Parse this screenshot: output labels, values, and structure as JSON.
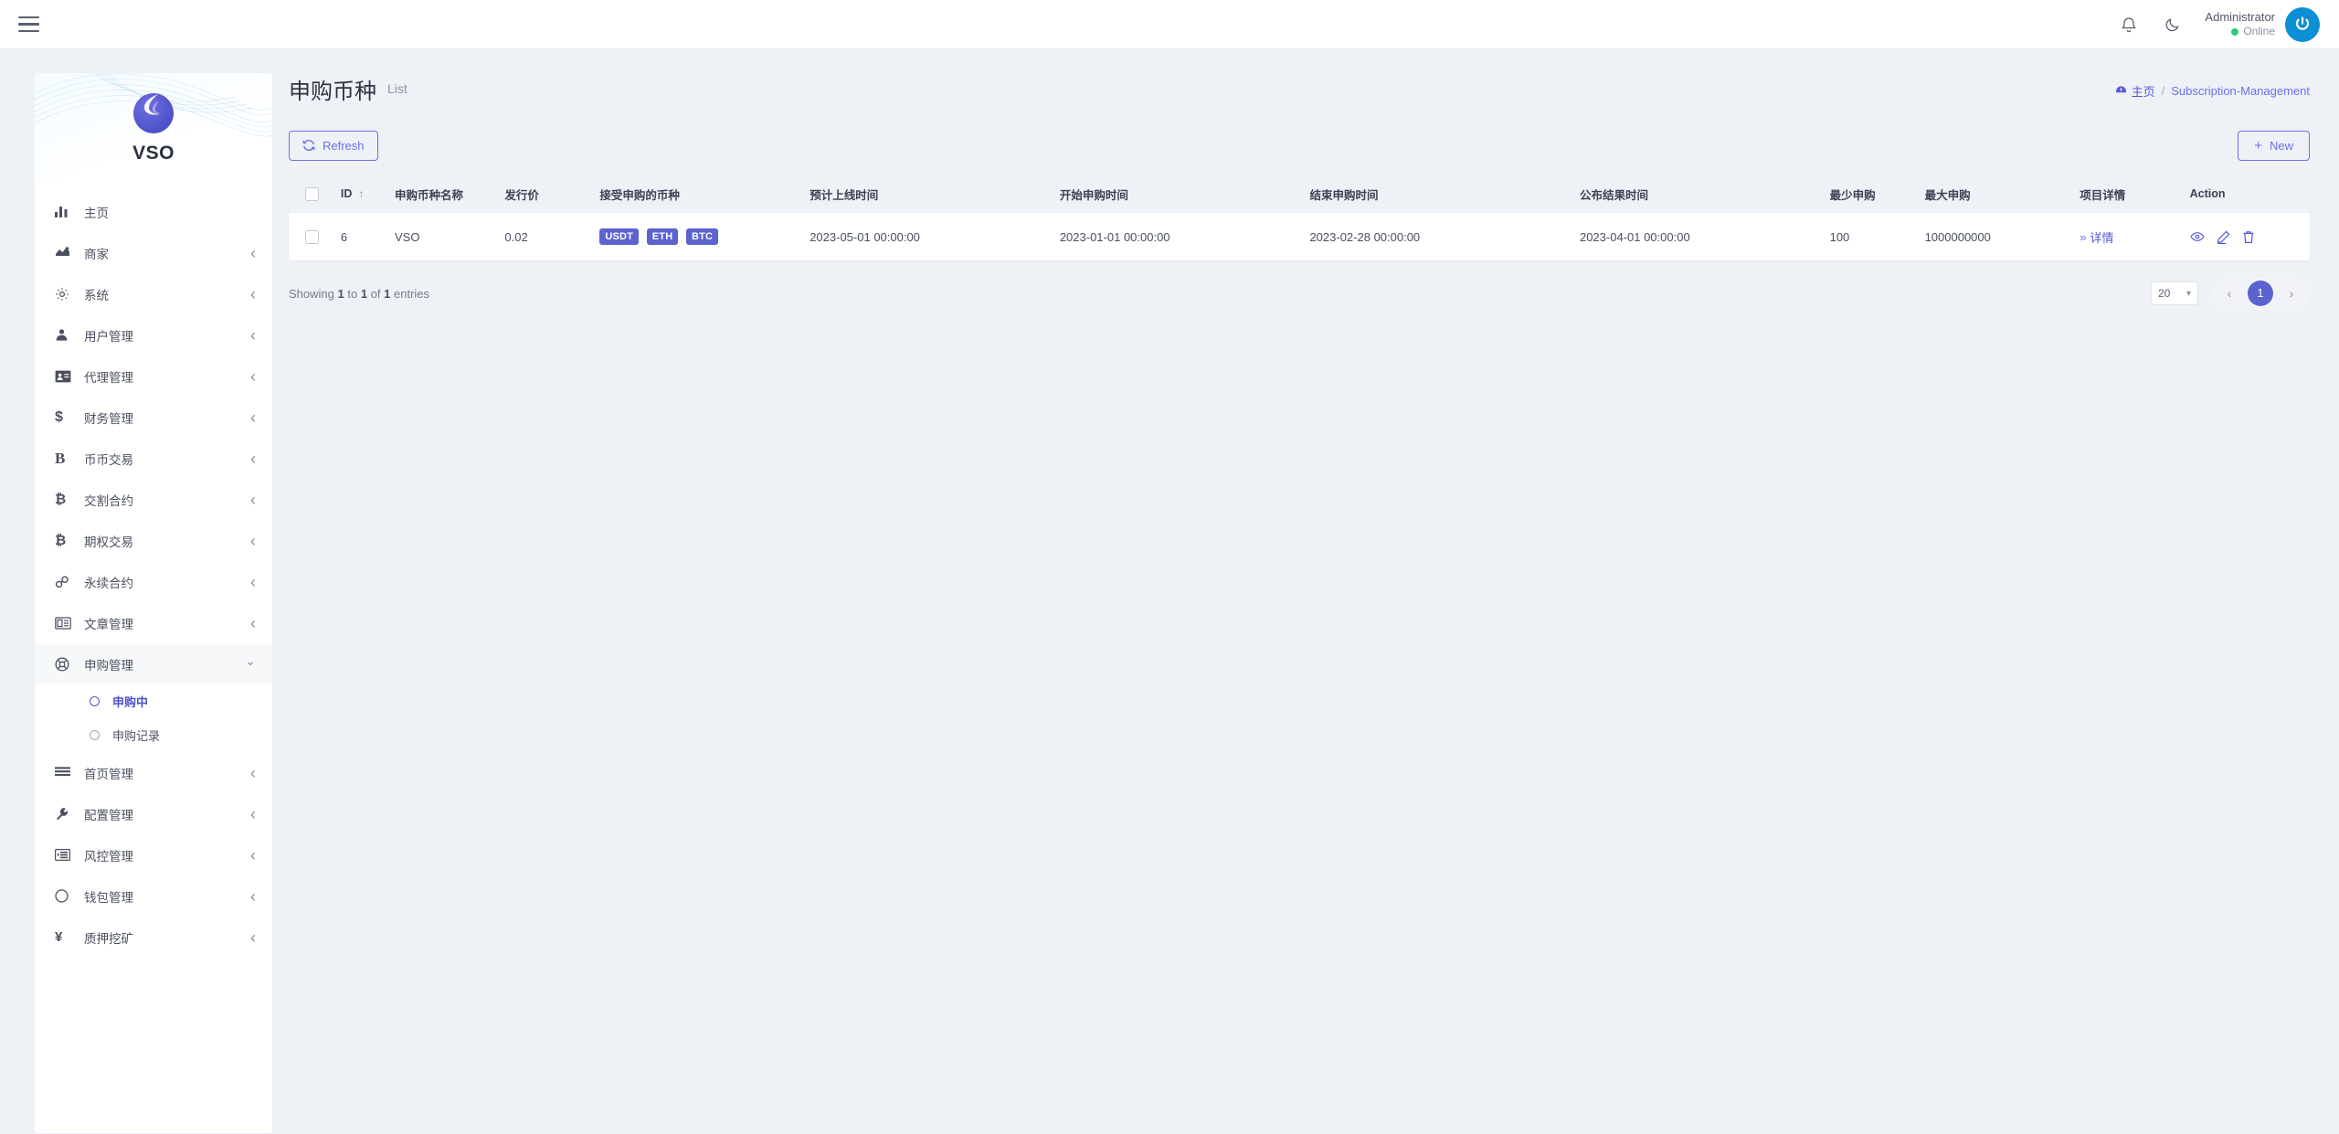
{
  "topbar": {
    "menu_icon": "hamburger-icon",
    "notification_icon": "bell-icon",
    "theme_icon": "moon-icon",
    "user_name": "Administrator",
    "user_status": "Online",
    "avatar_icon": "power-avatar-icon"
  },
  "sidebar": {
    "brand_name": "VSO",
    "items": [
      {
        "label": "主页",
        "icon": "chart-bars-icon",
        "caret": "none"
      },
      {
        "label": "商家",
        "icon": "merchant-icon",
        "caret": "left"
      },
      {
        "label": "系统",
        "icon": "gear-icon",
        "caret": "left"
      },
      {
        "label": "用户管理",
        "icon": "user-icon",
        "caret": "left"
      },
      {
        "label": "代理管理",
        "icon": "id-card-icon",
        "caret": "left"
      },
      {
        "label": "财务管理",
        "icon": "dollar-icon",
        "caret": "left"
      },
      {
        "label": "币币交易",
        "icon": "letter-b-icon",
        "caret": "left"
      },
      {
        "label": "交割合约",
        "icon": "bitcoin-icon",
        "caret": "left"
      },
      {
        "label": "期权交易",
        "icon": "bitcoin-icon",
        "caret": "left"
      },
      {
        "label": "永续合约",
        "icon": "link-icon",
        "caret": "left"
      },
      {
        "label": "文章管理",
        "icon": "article-icon",
        "caret": "left"
      },
      {
        "label": "申购管理",
        "icon": "lifebuoy-icon",
        "caret": "down"
      },
      {
        "label": "首页管理",
        "icon": "lines-icon",
        "caret": "left"
      },
      {
        "label": "配置管理",
        "icon": "wrench-icon",
        "caret": "left"
      },
      {
        "label": "风控管理",
        "icon": "risk-icon",
        "caret": "left"
      },
      {
        "label": "钱包管理",
        "icon": "circle-icon",
        "caret": "left"
      },
      {
        "label": "质押挖矿",
        "icon": "yen-icon",
        "caret": "left"
      }
    ],
    "submenu": [
      {
        "label": "申购中",
        "active": true
      },
      {
        "label": "申购记录",
        "active": false
      }
    ]
  },
  "page": {
    "title": "申购币种",
    "subtitle": "List",
    "breadcrumb_home": "主页",
    "breadcrumb_sep": "/",
    "breadcrumb_current": "Subscription-Management",
    "refresh_label": "Refresh",
    "new_label": "New",
    "new_plus": "+"
  },
  "table": {
    "sort_indicator": "↑",
    "columns": [
      "ID",
      "申购币种名称",
      "发行价",
      "接受申购的币种",
      "预计上线时间",
      "开始申购时间",
      "结束申购时间",
      "公布结果时间",
      "最少申购",
      "最大申购",
      "项目详情",
      "Action"
    ],
    "rows": [
      {
        "id": "6",
        "name": "VSO",
        "price": "0.02",
        "coins": [
          "USDT",
          "ETH",
          "BTC"
        ],
        "expected_online": "2023-05-01 00:00:00",
        "start_time": "2023-01-01 00:00:00",
        "end_time": "2023-02-28 00:00:00",
        "result_time": "2023-04-01 00:00:00",
        "min_amount": "100",
        "max_amount": "1000000000",
        "detail_label": "详情",
        "detail_chevrons": "»"
      }
    ]
  },
  "footer": {
    "showing_prefix": "Showing",
    "from": "1",
    "to_word": "to",
    "to": "1",
    "of_word": "of",
    "total": "1",
    "entries_word": "entries",
    "page_size": "20",
    "prev": "‹",
    "current_page": "1",
    "next": "›"
  },
  "colors": {
    "accent": "#5b63cf",
    "link": "#5558d8",
    "online": "#2ecb70",
    "page_bg": "#eef1f6"
  }
}
